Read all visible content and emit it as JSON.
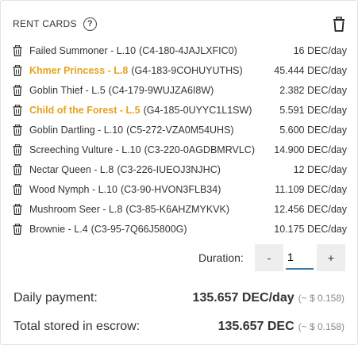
{
  "header": {
    "title": "RENT CARDS",
    "help_icon": "?"
  },
  "rows": [
    {
      "name": "Failed Summoner - L.10",
      "id": "(C4-180-4JAJLXFIC0)",
      "price": "16 DEC/day",
      "highlight": false
    },
    {
      "name": "Khmer Princess - L.8",
      "id": "(G4-183-9COHUYUTHS)",
      "price": "45.444 DEC/day",
      "highlight": true
    },
    {
      "name": "Goblin Thief - L.5",
      "id": "(C4-179-9WUJZA6I8W)",
      "price": "2.382 DEC/day",
      "highlight": false
    },
    {
      "name": "Child of the Forest - L.5",
      "id": "(G4-185-0UYYC1L1SW)",
      "price": "5.591 DEC/day",
      "highlight": true
    },
    {
      "name": "Goblin Dartling - L.10",
      "id": "(C5-272-VZA0M54UHS)",
      "price": "5.600 DEC/day",
      "highlight": false
    },
    {
      "name": "Screeching Vulture - L.10",
      "id": "(C3-220-0AGDBMRVLC)",
      "price": "14.900 DEC/day",
      "highlight": false
    },
    {
      "name": "Nectar Queen - L.8",
      "id": "(C3-226-IUEOJ3NJHC)",
      "price": "12 DEC/day",
      "highlight": false
    },
    {
      "name": "Wood Nymph - L.10",
      "id": "(C3-90-HVON3FLB34)",
      "price": "11.109 DEC/day",
      "highlight": false
    },
    {
      "name": "Mushroom Seer - L.8",
      "id": "(C3-85-K6AHZMYKVK)",
      "price": "12.456 DEC/day",
      "highlight": false
    },
    {
      "name": "Brownie - L.4",
      "id": "(C3-95-7Q66J5800G)",
      "price": "10.175 DEC/day",
      "highlight": false
    }
  ],
  "duration": {
    "label": "Duration:",
    "minus": "-",
    "plus": "+",
    "value": "1"
  },
  "summary": {
    "daily_label": "Daily payment:",
    "daily_value": "135.657 DEC/day",
    "daily_approx": "(~ $ 0.158)",
    "escrow_label": "Total stored in escrow:",
    "escrow_value": "135.657 DEC",
    "escrow_approx": "(~ $ 0.158)"
  },
  "colors": {
    "highlight": "#e9a21a",
    "input_underline": "#3a7ca5",
    "button_bg": "#eeeeee"
  },
  "icons": {
    "row_delete": "trash-icon",
    "clear_all": "trash-icon",
    "help": "help-icon"
  }
}
